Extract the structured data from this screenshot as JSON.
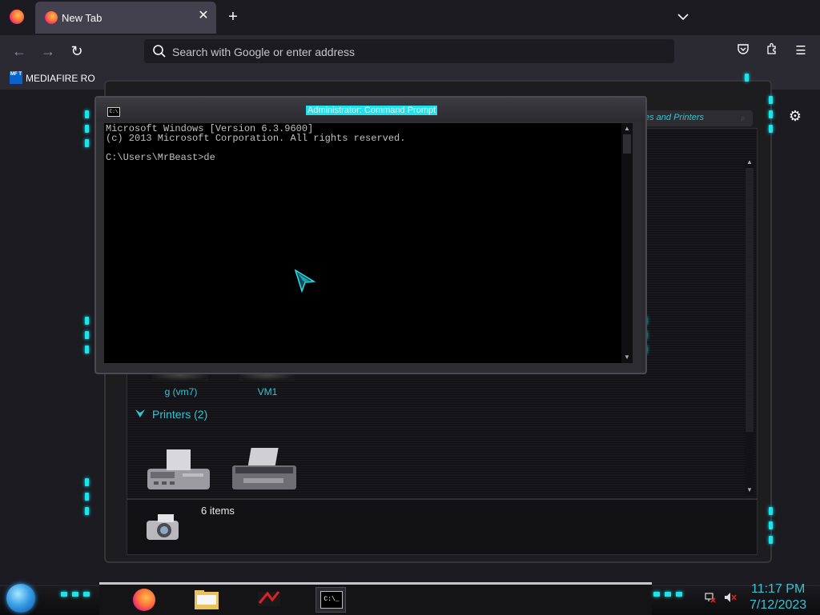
{
  "browser": {
    "tab": {
      "title": "New Tab"
    },
    "urlbar": {
      "placeholder": "Search with Google or enter address"
    },
    "bookmark": {
      "icon_text": "MF T",
      "label": "MEDIAFIRE RO"
    }
  },
  "explorer": {
    "search_text": "es and Printers",
    "devices": [
      {
        "label": "g (vm7)"
      },
      {
        "label": "VM1"
      }
    ],
    "printers_group": {
      "label": "Printers (2)"
    },
    "status": {
      "items_text": "6 items"
    }
  },
  "cmd": {
    "title": "Administrator: Command Prompt",
    "icon_text": "C:\\",
    "lines": [
      "Microsoft Windows [Version 6.3.9600]",
      "(c) 2013 Microsoft Corporation. All rights reserved.",
      "",
      "C:\\Users\\MrBeast>de"
    ]
  },
  "taskbar": {
    "cmd_icon_text": "C:\\_",
    "clock": {
      "time": "11:17 PM",
      "date": "7/12/2023"
    }
  },
  "colors": {
    "accent_cyan": "#1fe2ea",
    "console_bg": "#000000",
    "console_fg": "#c0c0c0",
    "firefox_bg": "#1c1b22"
  },
  "icons": [
    "firefox-icon",
    "back-icon",
    "forward-icon",
    "reload-icon",
    "search-icon",
    "pocket-icon",
    "extensions-icon",
    "menu-icon",
    "gear-icon",
    "printer-icon",
    "camera-icon",
    "folder-icon",
    "start-orb-icon",
    "network-icon",
    "volume-muted-icon"
  ]
}
